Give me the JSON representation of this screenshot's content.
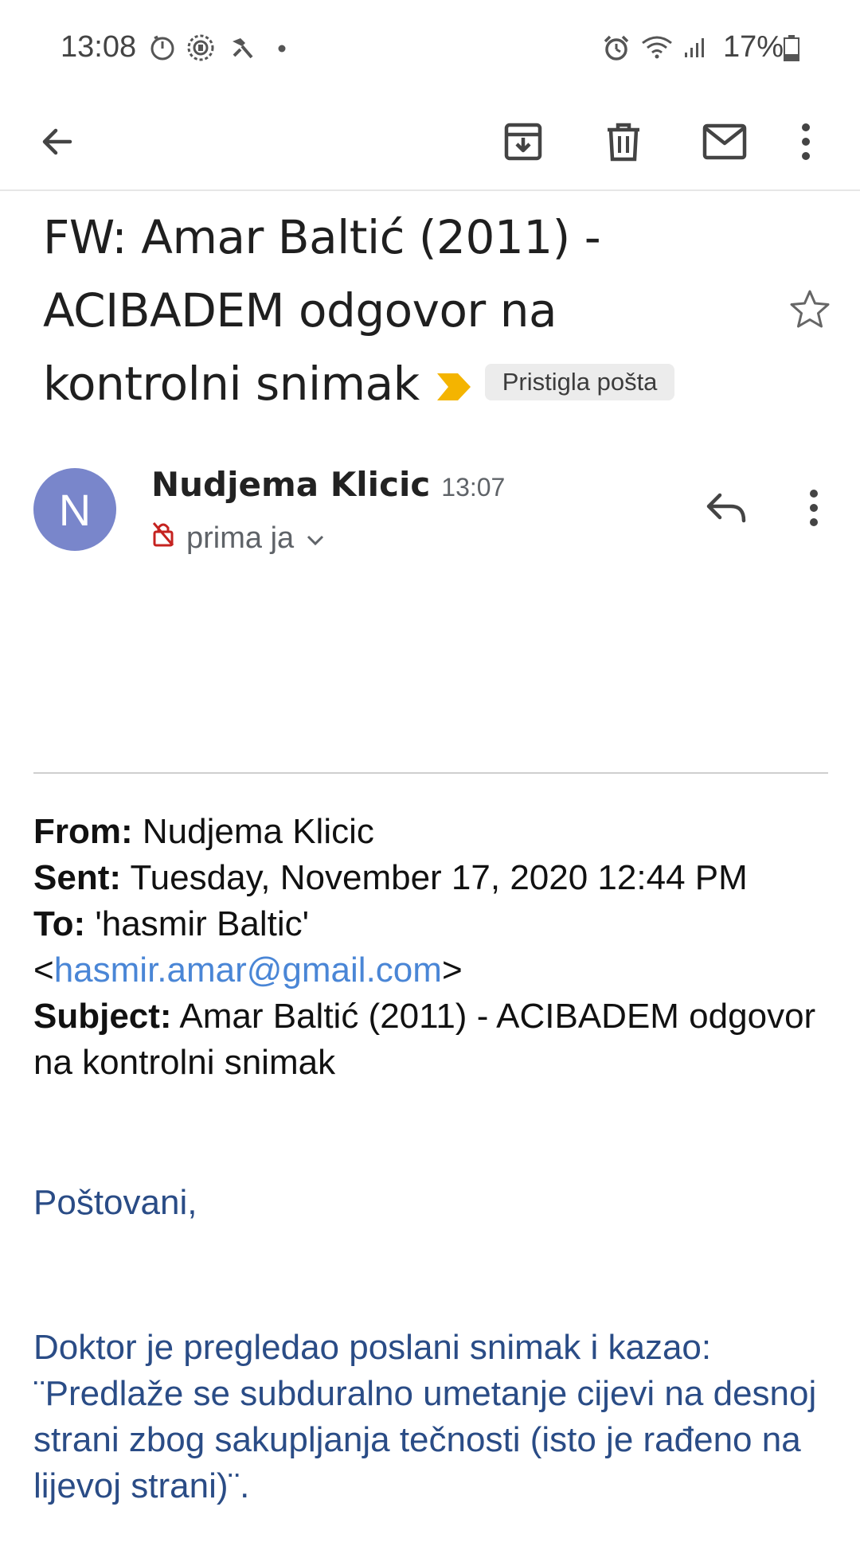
{
  "status_bar": {
    "time": "13:08",
    "battery_pct": "17%",
    "icons": [
      "timer-icon",
      "notification-app-icon",
      "tools-icon",
      "dot-icon",
      "alarm-icon",
      "wifi-icon",
      "signal-icon",
      "battery-icon"
    ]
  },
  "toolbar": {
    "back": "back-arrow-icon",
    "archive": "archive-icon",
    "delete": "trash-icon",
    "mark_unread": "mail-icon",
    "more": "more-vert-icon"
  },
  "email": {
    "subject_line1": "FW: Amar Baltić (2011) -",
    "subject_line2": "ACIBADEM odgovor na",
    "subject_line3": "kontrolni snimak",
    "label_chip": "Pristigla pošta",
    "sender_initial": "N",
    "sender_name": "Nudjema Klicic",
    "sent_time": "13:07",
    "recipient": "prima ja",
    "colors": {
      "avatar": "#7986cb",
      "important_marker": "#f4b400",
      "link": "#4a86d6",
      "body_text": "#2a4c86"
    }
  },
  "forwarded": {
    "from_label": "From:",
    "from_value": "Nudjema Klicic",
    "sent_label": "Sent:",
    "sent_value": "Tuesday, November 17, 2020 12:44 PM",
    "to_label": "To:",
    "to_value": "'hasmir Baltic'",
    "to_email_open": "<",
    "to_email": "hasmir.amar@gmail.com",
    "to_email_close": ">",
    "subject_label": "Subject:",
    "subject_value": "Amar Baltić (2011) - ACIBADEM odgovor na kontrolni snimak"
  },
  "body": {
    "greeting": "Poštovani,",
    "paragraph": "Doktor je pregledao poslani snimak i kazao: ¨Predlaže se subduralno umetanje cijevi na desnoj strani zbog sakupljanja tečnosti (isto je rađeno na lijevoj strani)¨."
  }
}
